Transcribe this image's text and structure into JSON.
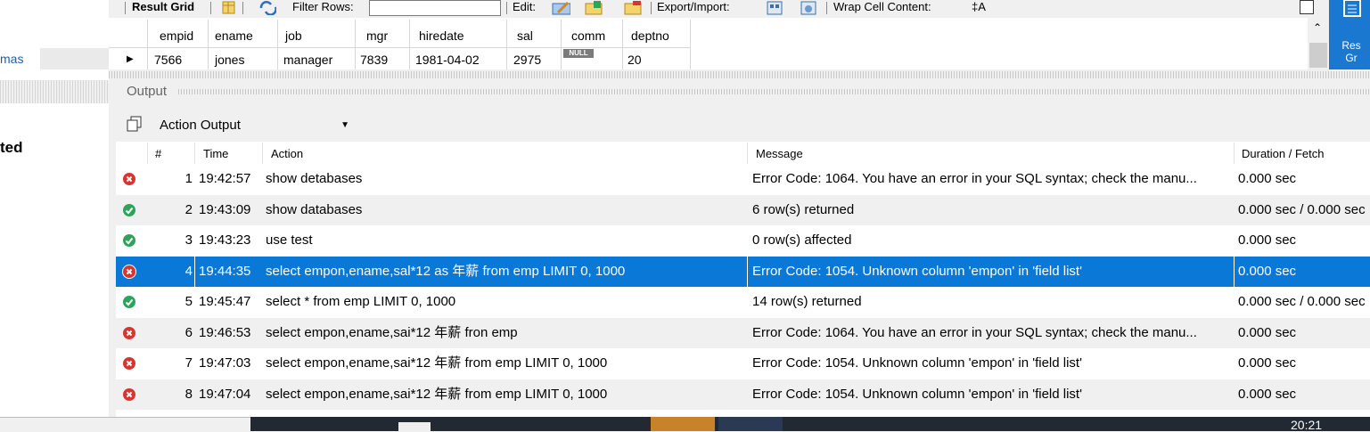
{
  "sidebar": {
    "schemas_tab": "mas",
    "section_label": "ted"
  },
  "toolbar": {
    "result_grid": "Result Grid",
    "filter_rows": "Filter Rows:",
    "edit": "Edit:",
    "export_import": "Export/Import:",
    "wrap_cell_content": "Wrap Cell Content:",
    "wrap_symbol": "‡A"
  },
  "result_grid": {
    "columns": [
      "empid",
      "ename",
      "job",
      "mgr",
      "hiredate",
      "sal",
      "comm",
      "deptno"
    ],
    "row": [
      "7566",
      "jones",
      "manager",
      "7839",
      "1981-04-02",
      "2975",
      "NULL",
      "20"
    ]
  },
  "right_panel": {
    "label_line1": "Res",
    "label_line2": "Gr"
  },
  "output": {
    "title": "Output",
    "selector": "Action Output",
    "columns": [
      "#",
      "Time",
      "Action",
      "Message",
      "Duration / Fetch"
    ],
    "rows": [
      {
        "num": "1",
        "time": "19:42:57",
        "action": "show detabases",
        "message": "Error Code: 1064. You have an error in your SQL syntax; check the manu...",
        "duration": "0.000 sec",
        "status": "error"
      },
      {
        "num": "2",
        "time": "19:43:09",
        "action": "show databases",
        "message": "6 row(s) returned",
        "duration": "0.000 sec / 0.000 sec",
        "status": "ok"
      },
      {
        "num": "3",
        "time": "19:43:23",
        "action": "use test",
        "message": "0 row(s) affected",
        "duration": "0.000 sec",
        "status": "ok"
      },
      {
        "num": "4",
        "time": "19:44:35",
        "action": "select empon,ename,sal*12 as 年薪 from emp LIMIT 0, 1000",
        "message": "Error Code: 1054. Unknown column 'empon' in 'field list'",
        "duration": "0.000 sec",
        "status": "error"
      },
      {
        "num": "5",
        "time": "19:45:47",
        "action": "select * from emp LIMIT 0, 1000",
        "message": "14 row(s) returned",
        "duration": "0.000 sec / 0.000 sec",
        "status": "ok"
      },
      {
        "num": "6",
        "time": "19:46:53",
        "action": "select empon,ename,sai*12 年薪 fron emp",
        "message": "Error Code: 1064. You have an error in your SQL syntax; check the manu...",
        "duration": "0.000 sec",
        "status": "error"
      },
      {
        "num": "7",
        "time": "19:47:03",
        "action": "select empon,ename,sai*12 年薪 from emp LIMIT 0, 1000",
        "message": "Error Code: 1054. Unknown column 'empon' in 'field list'",
        "duration": "0.000 sec",
        "status": "error"
      },
      {
        "num": "8",
        "time": "19:47:04",
        "action": "select empon,ename,sai*12 年薪 from emp LIMIT 0, 1000",
        "message": "Error Code: 1054. Unknown column 'empon' in 'field list'",
        "duration": "0.000 sec",
        "status": "error"
      }
    ]
  },
  "taskbar": {
    "clock": "20:21"
  },
  "colors": {
    "selection": "#0a78d7",
    "error": "#d9352e",
    "ok": "#2ca55b",
    "accent": "#1b78d0"
  }
}
